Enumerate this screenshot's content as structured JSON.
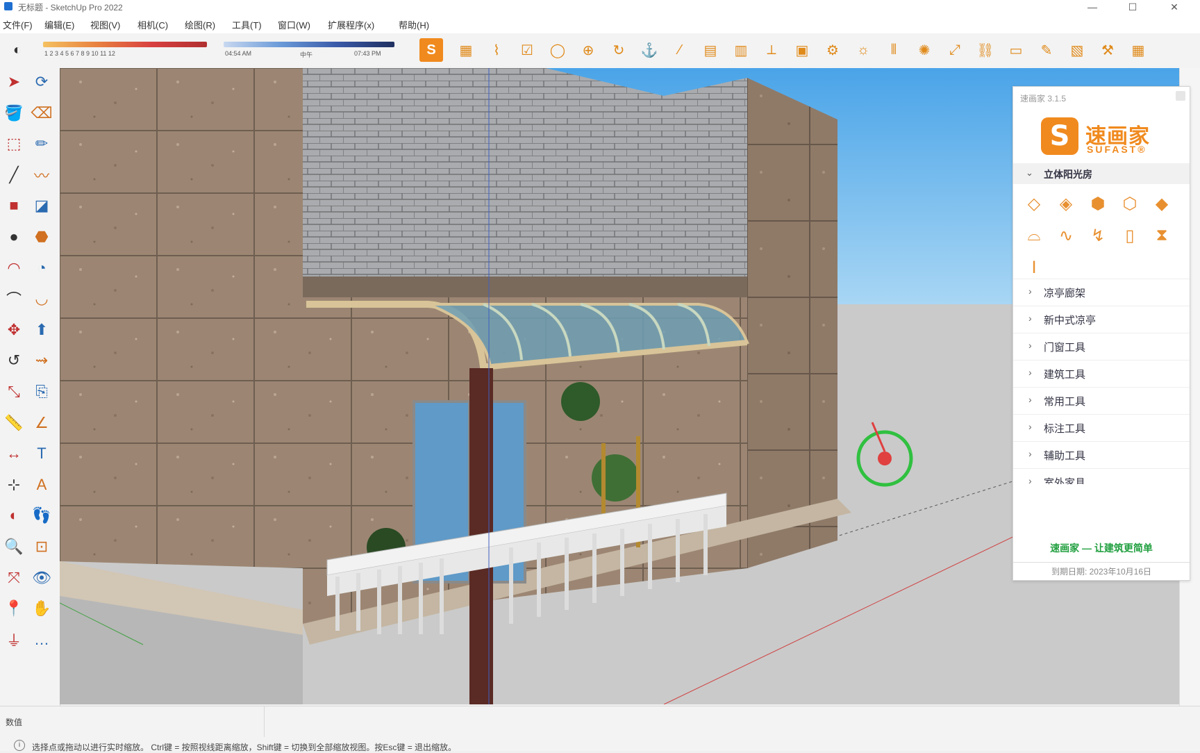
{
  "window": {
    "title": "无标题 - SketchUp Pro 2022",
    "minimize": "—",
    "maximize": "☐",
    "close": "✕"
  },
  "menu": [
    "文件(F)",
    "编辑(E)",
    "视图(V)",
    "相机(C)",
    "绘图(R)",
    "工具(T)",
    "窗口(W)",
    "扩展程序(x)",
    "帮助(H)"
  ],
  "toolbar": {
    "scale_ticks": "1 2 3 4 5 6 7 8 9 10 11 12",
    "time_left": "04:54 AM",
    "time_mid": "中午",
    "time_right": "07:43 PM",
    "icons": [
      "sufast-logo-icon",
      "box-icon",
      "section-icon",
      "curve-icon",
      "check-icon",
      "circle-icon",
      "zoom-icon",
      "rotate-icon",
      "anchor-icon",
      "pencil-line-icon",
      "grid-icon",
      "stair-icon",
      "axes-icon",
      "window-icon",
      "gear-icon",
      "sun-icon",
      "door-icon",
      "light-icon",
      "resize-icon",
      "path-icon",
      "image-icon",
      "paint-icon",
      "layers-icon",
      "settings-icon"
    ],
    "accent": "#e08a1a"
  },
  "left_tools": [
    "select-icon",
    "orbit-icon",
    "paint-bucket-icon",
    "eraser-icon",
    "component-icon",
    "pencil-icon",
    "line-icon",
    "freehand-icon",
    "rectangle-icon",
    "rotated-rect-icon",
    "circle-icon",
    "polygon-icon",
    "arc-icon",
    "pie-icon",
    "arc3-icon",
    "arc-2pt-icon",
    "move-icon",
    "push-pull-icon",
    "rotate-icon",
    "follow-me-icon",
    "scale-icon",
    "offset-icon",
    "tape-icon",
    "protractor-icon",
    "dimension-icon",
    "text-icon",
    "axes-icon",
    "3dtext-icon",
    "section-plane-icon",
    "walk-icon",
    "zoom-icon",
    "zoom-window-icon",
    "zoom-extents-icon",
    "look-around-icon",
    "position-camera-icon",
    "pan-icon",
    "footprint-icon",
    "extra-icon"
  ],
  "panel": {
    "title": "速画家 3.1.5",
    "logo_letter": "S",
    "logo_cn": "速画家",
    "logo_en": "SUFAST®",
    "section_open": "立体阳光房",
    "icons": [
      "roof-panel-icon",
      "roof-slope-icon",
      "roof-box-icon",
      "roof-flat-icon",
      "roof-corner-icon",
      "roof-curve-icon",
      "roof-wave-icon",
      "roof-bend-icon",
      "pillar-icon",
      "column-icon",
      "beam-icon"
    ],
    "items": [
      "凉亭廊架",
      "新中式凉亭",
      "门窗工具",
      "建筑工具",
      "常用工具",
      "标注工具",
      "辅助工具",
      "室外家具"
    ],
    "slogan": "速画家 — 让建筑更简单",
    "expire": "到期日期: 2023年10月16日"
  },
  "status": {
    "measure_label": "数值",
    "info": "i",
    "hint": "选择点或拖动以进行实时缩放。 Ctrl键 = 按照视线距离缩放，Shift键 = 切换到全部缩放视图。按Esc键 = 退出缩放。"
  }
}
